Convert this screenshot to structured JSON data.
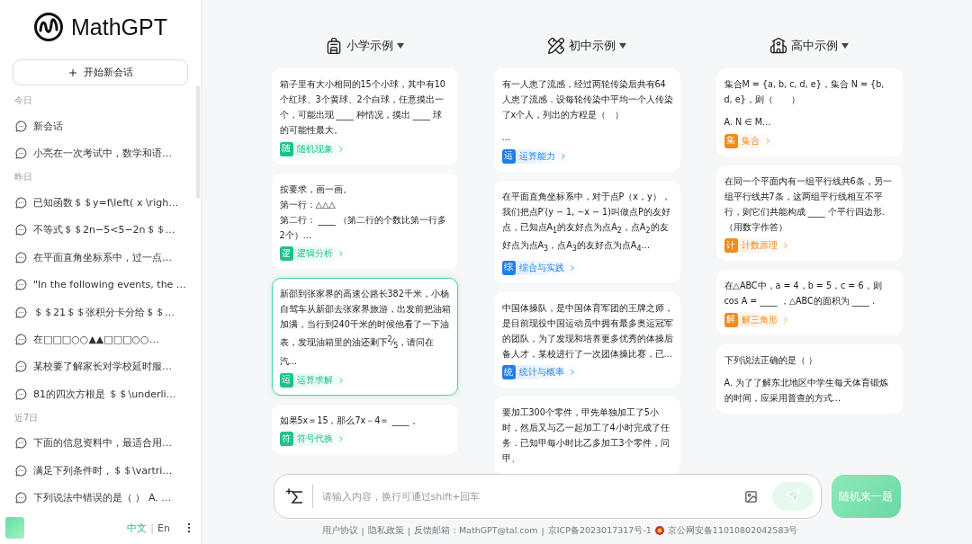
{
  "sidebar": {
    "logo": "MathGPT",
    "new_chat": "开始新会话",
    "groups": [
      {
        "label": "今日",
        "items": [
          "新会话",
          "小亮在一次考试中，数学和语…"
        ]
      },
      {
        "label": "昨日",
        "items": [
          "已知函数＄＄y=f\\left( x \\righ…",
          "不等式＄＄2n−5<5−2n＄＄…",
          "在平面直角坐标系中，过一点…",
          "\"In the following events, the …",
          "＄＄21＄＄张积分卡分给＄＄…",
          "在□□□○○▲▲□□□○○…",
          "某校要了解家长对学校延时服…",
          "81的四次方根是 ＄＄\\underli…"
        ]
      },
      {
        "label": "近7日",
        "items": [
          "下面的信息资料中，最适合用…",
          "满足下列条件时，＄＄\\vartri…",
          "下列说法中错误的是（ ） A. …"
        ]
      }
    ],
    "languages": [
      {
        "label": "中文",
        "selected": true
      },
      {
        "kind": "divider",
        "label": "|"
      },
      {
        "label": "En",
        "selected": false
      }
    ]
  },
  "columns": [
    {
      "title": "小学示例",
      "color": "#1cc28c",
      "cards": [
        {
          "text": [
            "箱子里有大小相同的15个小球，其中有10个红球、3个黄球、2个白球，任意摸出一个，可能出现 ____ 种情况，摸出 ____ 球的可能性最大。"
          ],
          "badge": "随",
          "tag": "随机现象",
          "selected": false
        },
        {
          "text": [
            "按要求，画一画。",
            "第一行：△△△",
            "第二行： ____ （第二行的个数比第一行多2个）…"
          ],
          "badge": "逻",
          "tag": "逻辑分析",
          "selected": false
        },
        {
          "text": [
            "新邵到张家界的高速公路长382千米，小杨自驾车从新邵去张家界旅游，出发前把油箱加满，当行到240千米的时候他看了一下油表，发现油箱里的油还剩下$^{2}$⁄$_{5}$，请问在汽…"
          ],
          "badge": "运",
          "tag": "运算求解",
          "selected": true
        },
        {
          "text": [
            "如果5x＝15，那么7x－4＝ ____ 。"
          ],
          "badge": "符",
          "tag": "符号代换",
          "selected": false
        }
      ]
    },
    {
      "title": "初中示例",
      "color": "#1f7fe8",
      "cards": [
        {
          "text": [
            "有一人患了流感，经过两轮传染后共有64人患了流感．设每轮传染中平均一个人传染了x个人，列出的方程是（　）",
            "…"
          ],
          "badge": "运",
          "tag": "运算能力",
          "selected": false
        },
        {
          "text": [
            "在平面直角坐标系中，对于点P（x，y），我们把点P′(y − 1, −x − 1)叫做点P的友好点，已知点A$_{1}$的友好点为点A$_{2}$，点A$_{2}$的友好点为点A$_{3}$，点A$_{3}$的友好点为点A$_{4}$…"
          ],
          "badge": "综",
          "tag": "综合与实践",
          "selected": false
        },
        {
          "text": [
            "中国体操队，是中国体育军团的王牌之师，是目前现役中国运动员中拥有最多奥运冠军的团队，为了发现和培养更多优秀的体操后备人才，某校进行了一次团体操比赛，已…"
          ],
          "badge": "统",
          "tag": "统计与概率",
          "selected": false
        },
        {
          "text": [
            "要加工300个零件，甲先单独加工了5小时，然后又与乙一起加工了4小时完成了任务．已知甲每小时比乙多加工3个零件，问甲、"
          ],
          "selected": false
        }
      ]
    },
    {
      "title": "高中示例",
      "color": "#f28a1c",
      "cards": [
        {
          "text": [
            "集合M = {a, b, c, d, e}，集合 N = {b, d, e}，则（　　）",
            "A. N ∈ M…"
          ],
          "badge": "集",
          "tag": "集合",
          "selected": false
        },
        {
          "text": [
            "在同一个平面内有一组平行线共6条，另一组平行线共7条，这两组平行线相互不平行，则它们共能构成 ____ 个平行四边形.（用数字作答）"
          ],
          "badge": "计",
          "tag": "计数原理",
          "selected": false
        },
        {
          "text": [
            "在△ABC中，a = 4，b = 5，c = 6，则cos A = ____ ，△ABC的面积为 ____ ."
          ],
          "badge": "解",
          "tag": "解三角形",
          "selected": false
        },
        {
          "text": [
            "下列说法正确的是（ ）",
            "A. 为了了解东北地区中学生每天体育锻炼的时间，应采用普查的方式…"
          ],
          "selected": false
        }
      ]
    }
  ],
  "composer": {
    "placeholder": "请输入内容，换行可通过shift+回车"
  },
  "random_button": "随机来一题",
  "footer": [
    {
      "kind": "link",
      "text": "用户协议"
    },
    {
      "kind": "divider",
      "text": "|"
    },
    {
      "kind": "link",
      "text": "隐私政策"
    },
    {
      "kind": "divider",
      "text": "|"
    },
    {
      "kind": "text",
      "text": "反馈邮箱：MathGPT@tal.com"
    },
    {
      "kind": "divider",
      "text": "|"
    },
    {
      "kind": "link",
      "text": "京ICP备2023017317号-1"
    },
    {
      "kind": "emblem"
    },
    {
      "kind": "link",
      "text": "京公网安备11010802042583号"
    }
  ]
}
